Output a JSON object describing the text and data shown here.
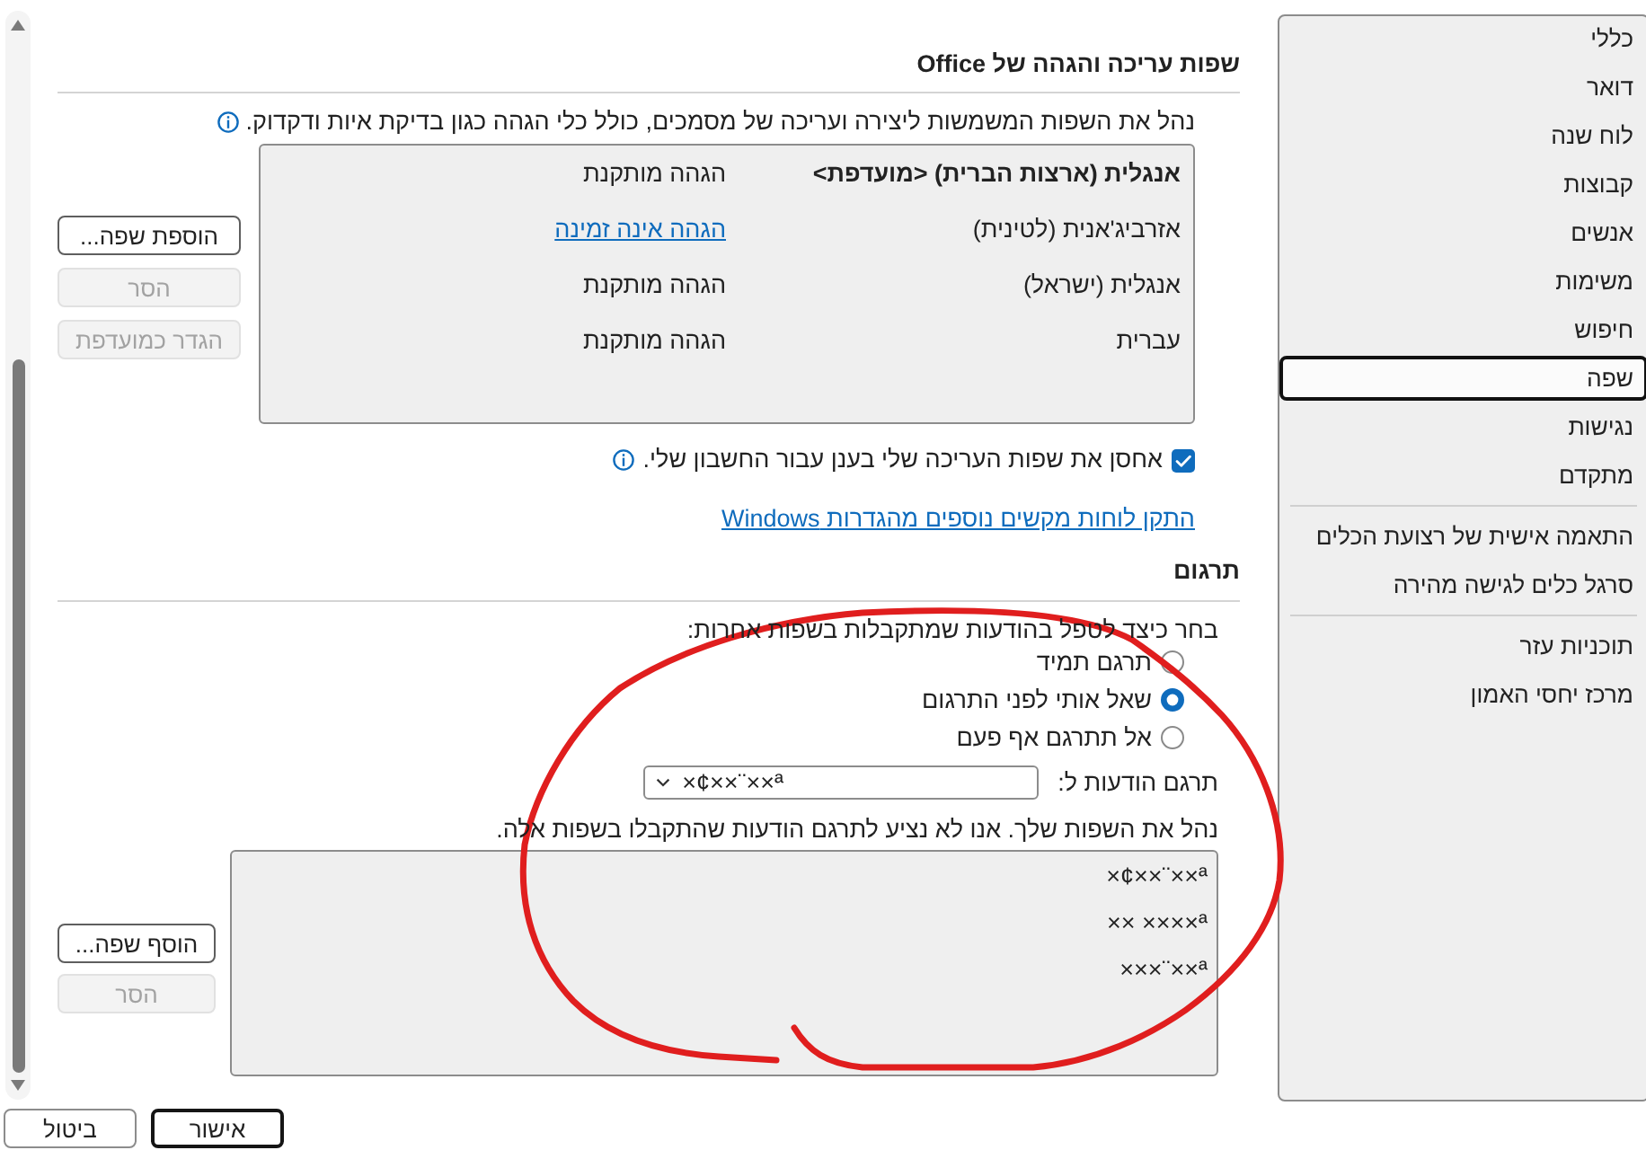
{
  "sidebar": {
    "groups": [
      {
        "items": [
          {
            "label": "כללי",
            "selected": false
          },
          {
            "label": "דואר",
            "selected": false
          },
          {
            "label": "לוח שנה",
            "selected": false
          },
          {
            "label": "קבוצות",
            "selected": false
          },
          {
            "label": "אנשים",
            "selected": false
          },
          {
            "label": "משימות",
            "selected": false
          },
          {
            "label": "חיפוש",
            "selected": false
          },
          {
            "label": "שפה",
            "selected": true
          },
          {
            "label": "נגישות",
            "selected": false
          },
          {
            "label": "מתקדם",
            "selected": false
          }
        ]
      },
      {
        "items": [
          {
            "label": "התאמה אישית של רצועת הכלים",
            "selected": false
          },
          {
            "label": "סרגל כלים לגישה מהירה",
            "selected": false
          }
        ]
      },
      {
        "items": [
          {
            "label": "תוכניות עזר",
            "selected": false
          },
          {
            "label": "מרכז יחסי האמון",
            "selected": false
          }
        ]
      }
    ]
  },
  "editing": {
    "title": "שפות עריכה והגהה של Office",
    "description": "נהל את השפות המשמשות ליצירה ועריכה של מסמכים, כולל כלי הגהה כגון בדיקת איות ודקדוק.",
    "languages": [
      {
        "language": "אנגלית (ארצות הברית) <מועדפת>",
        "preferred": true,
        "proofing": "הגהה מותקנת",
        "proofing_link": false
      },
      {
        "language": "אזרביג'אנית (לטינית)",
        "preferred": false,
        "proofing": "הגהה אינה זמינה",
        "proofing_link": true
      },
      {
        "language": "אנגלית (ישראל)",
        "preferred": false,
        "proofing": "הגהה מותקנת",
        "proofing_link": false
      },
      {
        "language": "עברית",
        "preferred": false,
        "proofing": "הגהה מותקנת",
        "proofing_link": false
      }
    ],
    "buttons": [
      {
        "label": "הוספת שפה...",
        "disabled": false
      },
      {
        "label": "הסר",
        "disabled": true
      },
      {
        "label": "הגדר כמועדפת",
        "disabled": true
      }
    ],
    "cloud_storage": {
      "label": "אחסן את שפות העריכה שלי בענן עבור החשבון שלי.",
      "checked": true
    },
    "keyboards_link": "התקן לוחות מקשים נוספים מהגדרות Windows"
  },
  "translation": {
    "title": "תרגום",
    "prompt": "בחר כיצד לטפל בהודעות שמתקבלות בשפות אחרות:",
    "options": [
      {
        "label": "תרגם תמיד",
        "selected": false
      },
      {
        "label": "שאל אותי לפני התרגום",
        "selected": true
      },
      {
        "label": "אל תתרגם אף פעם",
        "selected": false
      }
    ],
    "translate_to": {
      "label": "תרגם הודעות ל:",
      "value": "×¢××¨××ª"
    },
    "languages_note": "נהל את השפות שלך. אנו לא נציע לתרגם הודעות שהתקבלו בשפות אלה.",
    "languages": [
      "×¢××¨××ª",
      "×× ××××ª",
      "×××¨××ª"
    ],
    "buttons": [
      {
        "label": "הוסף שפה...",
        "disabled": false
      },
      {
        "label": "הסר",
        "disabled": true
      }
    ]
  },
  "footer": {
    "buttons": [
      {
        "label": "אישור",
        "default": true
      },
      {
        "label": "ביטול",
        "default": false
      }
    ]
  }
}
